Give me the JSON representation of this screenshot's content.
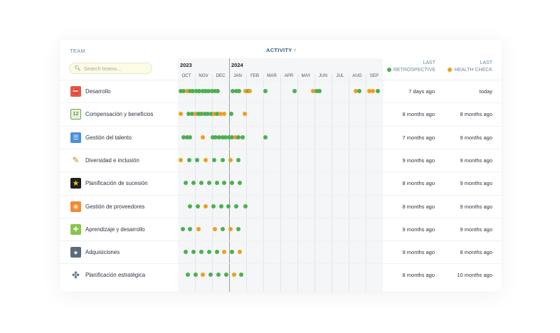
{
  "header": {
    "team_label": "TEAM",
    "activity_label": "ACTIVITY",
    "activity_sort_icon": "arrow-up-icon",
    "search_placeholder": "Search teams...",
    "last_retro_line1": "LAST",
    "last_retro_line2": "RETROSPECTIVE",
    "last_health_line1": "LAST",
    "last_health_line2": "HEALTH CHECK"
  },
  "colors": {
    "retrospective": "#4caf50",
    "health_check": "#f39c1e"
  },
  "timeline": {
    "years": [
      {
        "label": "2023",
        "month_index": 0
      },
      {
        "label": "2024",
        "month_index": 3
      }
    ],
    "months": [
      "OCT",
      "NOV",
      "DEC",
      "JAN",
      "FEB",
      "MAR",
      "APR",
      "MAY",
      "JUN",
      "JUL",
      "AUG",
      "SEP"
    ],
    "today_month_index": 2.95
  },
  "teams": [
    {
      "name": "Desarrollo",
      "icon": "ban-tool-icon",
      "last_retrospective": "7 days ago",
      "last_health_check": "today",
      "events": [
        [
          0.05,
          "g"
        ],
        [
          0.22,
          "g"
        ],
        [
          0.4,
          "o"
        ],
        [
          0.58,
          "g"
        ],
        [
          0.77,
          "g"
        ],
        [
          0.95,
          "g"
        ],
        [
          1.13,
          "g"
        ],
        [
          1.32,
          "g"
        ],
        [
          1.5,
          "g"
        ],
        [
          1.68,
          "g"
        ],
        [
          1.87,
          "g"
        ],
        [
          2.05,
          "g"
        ],
        [
          2.22,
          "g"
        ],
        [
          3.1,
          "g"
        ],
        [
          3.28,
          "g"
        ],
        [
          3.46,
          "g"
        ],
        [
          3.85,
          "o"
        ],
        [
          4.0,
          "g"
        ],
        [
          4.1,
          "o"
        ],
        [
          5.0,
          "g"
        ],
        [
          6.7,
          "g"
        ],
        [
          7.8,
          "o"
        ],
        [
          8.0,
          "g"
        ],
        [
          8.18,
          "g"
        ],
        [
          10.3,
          "o"
        ],
        [
          10.5,
          "g"
        ],
        [
          11.1,
          "o"
        ],
        [
          11.28,
          "o"
        ],
        [
          11.6,
          "g"
        ]
      ]
    },
    {
      "name": "Compensación y beneficios",
      "icon": "calendar-icon",
      "last_retrospective": "8 months ago",
      "last_health_check": "8 months ago",
      "events": [
        [
          0.05,
          "o"
        ],
        [
          0.5,
          "g"
        ],
        [
          0.7,
          "g"
        ],
        [
          0.9,
          "o"
        ],
        [
          1.08,
          "g"
        ],
        [
          1.27,
          "g"
        ],
        [
          1.45,
          "g"
        ],
        [
          1.63,
          "g"
        ],
        [
          1.82,
          "g"
        ],
        [
          2.0,
          "o"
        ],
        [
          2.18,
          "g"
        ],
        [
          2.37,
          "o"
        ],
        [
          2.6,
          "o"
        ],
        [
          3.0,
          "g"
        ],
        [
          3.8,
          "o"
        ]
      ]
    },
    {
      "name": "Gestión del talento",
      "icon": "id-card-icon",
      "last_retrospective": "7 months ago",
      "last_health_check": "9 months ago",
      "events": [
        [
          0.2,
          "g"
        ],
        [
          0.4,
          "g"
        ],
        [
          0.58,
          "g"
        ],
        [
          1.35,
          "o"
        ],
        [
          1.9,
          "g"
        ],
        [
          2.1,
          "g"
        ],
        [
          2.3,
          "g"
        ],
        [
          2.5,
          "g"
        ],
        [
          2.68,
          "g"
        ],
        [
          2.86,
          "g"
        ],
        [
          3.05,
          "g"
        ],
        [
          3.25,
          "o"
        ],
        [
          3.42,
          "g"
        ],
        [
          3.65,
          "g"
        ],
        [
          5.0,
          "g"
        ]
      ]
    },
    {
      "name": "Diversidad e inclusión",
      "icon": "paintbrush-icon",
      "last_retrospective": "9 months ago",
      "last_health_check": "9 months ago",
      "events": [
        [
          0.05,
          "o"
        ],
        [
          0.55,
          "g"
        ],
        [
          1.0,
          "g"
        ],
        [
          1.5,
          "o"
        ],
        [
          2.0,
          "g"
        ],
        [
          2.5,
          "g"
        ],
        [
          2.95,
          "o"
        ],
        [
          3.4,
          "g"
        ]
      ]
    },
    {
      "name": "Planificación de sucesión",
      "icon": "star-icon",
      "last_retrospective": "8 months ago",
      "last_health_check": "9 months ago",
      "events": [
        [
          0.35,
          "g"
        ],
        [
          0.8,
          "g"
        ],
        [
          1.25,
          "g"
        ],
        [
          1.7,
          "g"
        ],
        [
          2.15,
          "g"
        ],
        [
          2.6,
          "g"
        ],
        [
          3.05,
          "g"
        ],
        [
          3.5,
          "g"
        ]
      ]
    },
    {
      "name": "Gestión de proveedores",
      "icon": "store-icon",
      "last_retrospective": "8 months ago",
      "last_health_check": "9 months ago",
      "events": [
        [
          0.6,
          "g"
        ],
        [
          1.05,
          "g"
        ],
        [
          1.5,
          "o"
        ],
        [
          1.95,
          "g"
        ],
        [
          2.4,
          "g"
        ],
        [
          2.85,
          "g"
        ],
        [
          3.3,
          "g"
        ],
        [
          3.85,
          "g"
        ]
      ]
    },
    {
      "name": "Aprendizaje y desarrollo",
      "icon": "learning-icon",
      "last_retrospective": "9 months ago",
      "last_health_check": "9 months ago",
      "events": [
        [
          0.15,
          "g"
        ],
        [
          0.6,
          "g"
        ],
        [
          1.1,
          "o"
        ],
        [
          2.05,
          "o"
        ],
        [
          2.5,
          "g"
        ],
        [
          2.95,
          "o"
        ],
        [
          3.4,
          "g"
        ]
      ]
    },
    {
      "name": "Adquisiciones",
      "icon": "diamond-icon",
      "last_retrospective": "9 months ago",
      "last_health_check": "8 months ago",
      "events": [
        [
          0.35,
          "g"
        ],
        [
          0.8,
          "g"
        ],
        [
          1.25,
          "g"
        ],
        [
          1.7,
          "g"
        ],
        [
          2.15,
          "g"
        ],
        [
          2.6,
          "o"
        ],
        [
          3.05,
          "g"
        ],
        [
          3.5,
          "o"
        ]
      ]
    },
    {
      "name": "Planificación estratégica",
      "icon": "puzzle-icon",
      "last_retrospective": "8 months ago",
      "last_health_check": "10 months ago",
      "events": [
        [
          0.45,
          "g"
        ],
        [
          0.9,
          "g"
        ],
        [
          1.35,
          "o"
        ],
        [
          1.8,
          "g"
        ],
        [
          2.25,
          "g"
        ],
        [
          2.7,
          "g"
        ],
        [
          3.15,
          "o"
        ],
        [
          3.6,
          "g"
        ]
      ]
    }
  ]
}
